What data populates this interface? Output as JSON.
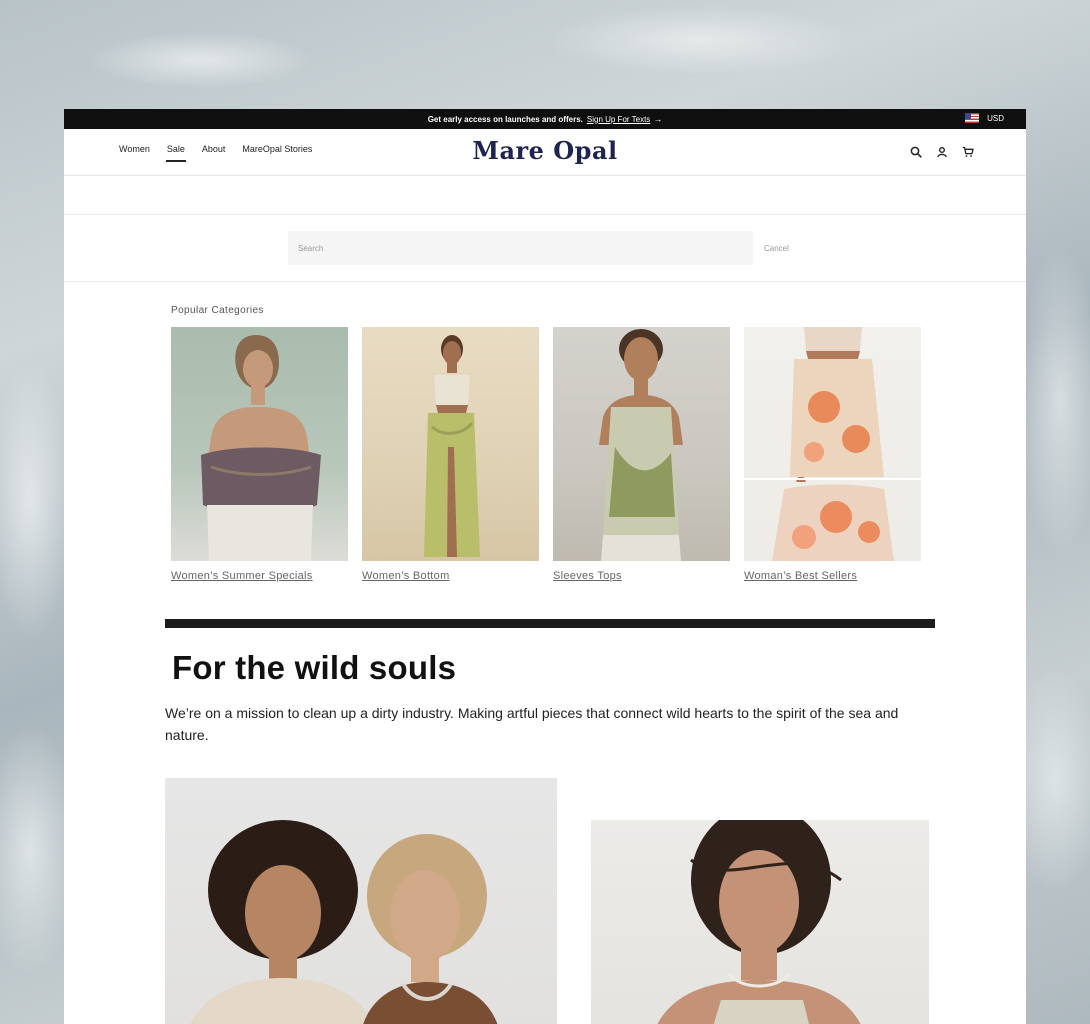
{
  "announcement": {
    "message": "Get early access on launches and offers.",
    "cta": "Sign Up For Texts",
    "arrow": "→",
    "currency": "USD"
  },
  "header": {
    "nav": [
      "Women",
      "Sale",
      "About",
      "MareOpal Stories"
    ],
    "active_nav": "Sale",
    "logo": "Mare Opal",
    "icons": [
      "search-icon",
      "account-icon",
      "cart-icon"
    ]
  },
  "search": {
    "placeholder": "Search",
    "cancel_label": "Cancel"
  },
  "popular": {
    "title": "Popular Categories",
    "categories": [
      {
        "label": "Women’s Summer Specials"
      },
      {
        "label": "Women’s Bottom"
      },
      {
        "label": "Sleeves Tops"
      },
      {
        "label": "Woman’s Best Sellers"
      }
    ]
  },
  "story": {
    "title": "For the wild souls",
    "body": "We’re on a mission to clean up a dirty industry. Making artful pieces that connect wild hearts to the spirit of the sea and nature."
  }
}
